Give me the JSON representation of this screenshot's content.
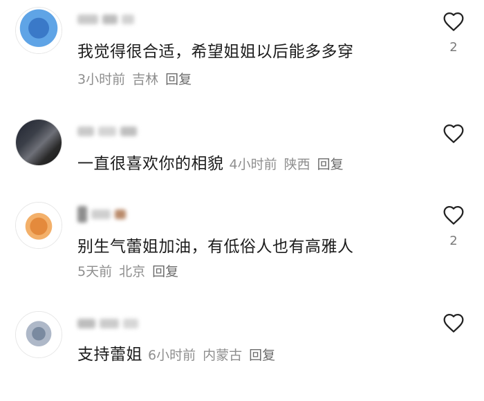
{
  "comments": [
    {
      "avatar_colors": [
        "#3a79c8",
        "#5fa4e6",
        "#2e5fa2"
      ],
      "username_blur_colors": [
        "#c9c9c9",
        "#bdbdbd",
        "#d2d2d2"
      ],
      "text": "我觉得很合适，希望姐姐以后能多多穿",
      "meta_inline": false,
      "time": "3小时前",
      "location": "吉林",
      "reply_label": "回复",
      "like_count": "2"
    },
    {
      "avatar_colors": [
        "#1f2330",
        "#5a5e66",
        "#2a2a2a"
      ],
      "username_blur_colors": [
        "#c9c9c9",
        "#d4d4d4",
        "#bfbfbf"
      ],
      "text": "一直很喜欢你的相貌",
      "meta_inline": true,
      "time": "4小时前",
      "location": "陕西",
      "reply_label": "回复",
      "like_count": ""
    },
    {
      "avatar_colors": [
        "#e48a3c",
        "#f3b06a",
        "#b65f1f"
      ],
      "username_blur_colors": [
        "#8e8e8e",
        "#cfcfcf",
        "#b98a6a"
      ],
      "text": "别生气蕾姐加油，有低俗人也有高雅人",
      "meta_inline": false,
      "time": "5天前",
      "location": "北京",
      "reply_label": "回复",
      "like_count": "2"
    },
    {
      "avatar_colors": [
        "#7a8aa0",
        "#aeb8c8",
        "#5d6b80"
      ],
      "username_blur_colors": [
        "#bdbdbd",
        "#cbcbcb",
        "#d6d6d6"
      ],
      "text": "支持蕾姐",
      "meta_inline": true,
      "time": "6小时前",
      "location": "内蒙古",
      "reply_label": "回复",
      "like_count": ""
    }
  ]
}
